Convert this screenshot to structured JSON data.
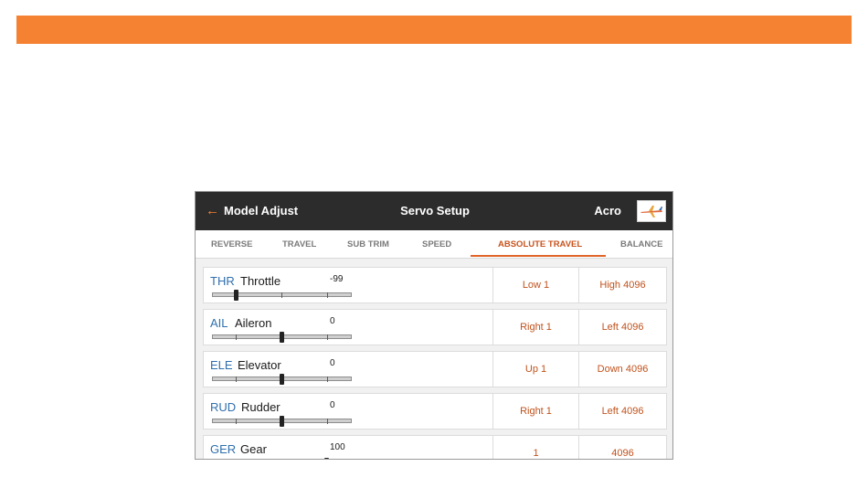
{
  "header": {
    "back_label": "Model Adjust",
    "title": "Servo Setup",
    "model_name": "Acro"
  },
  "tabs": [
    {
      "label": "REVERSE",
      "active": false
    },
    {
      "label": "TRAVEL",
      "active": false
    },
    {
      "label": "SUB TRIM",
      "active": false
    },
    {
      "label": "SPEED",
      "active": false
    },
    {
      "label": "ABSOLUTE TRAVEL",
      "active": true
    },
    {
      "label": "BALANCE",
      "active": false
    }
  ],
  "channels": [
    {
      "code": "THR",
      "name": "Throttle",
      "value": "-99",
      "position": 0.01,
      "low": "Low 1",
      "high": "High 4096"
    },
    {
      "code": "AIL",
      "name": "Aileron",
      "value": "0",
      "position": 0.5,
      "low": "Right 1",
      "high": "Left 4096"
    },
    {
      "code": "ELE",
      "name": "Elevator",
      "value": "0",
      "position": 0.5,
      "low": "Up 1",
      "high": "Down 4096"
    },
    {
      "code": "RUD",
      "name": "Rudder",
      "value": "0",
      "position": 0.5,
      "low": "Right 1",
      "high": "Left 4096"
    },
    {
      "code": "GER",
      "name": "Gear",
      "value": "100",
      "position": 1.0,
      "low": "1",
      "high": "4096"
    }
  ],
  "colors": {
    "accent": "#f58233",
    "active_tab": "#c8531d",
    "channel_code": "#2f6fad",
    "value_cell": "#c0521c",
    "topbar": "#2c2c2c"
  }
}
